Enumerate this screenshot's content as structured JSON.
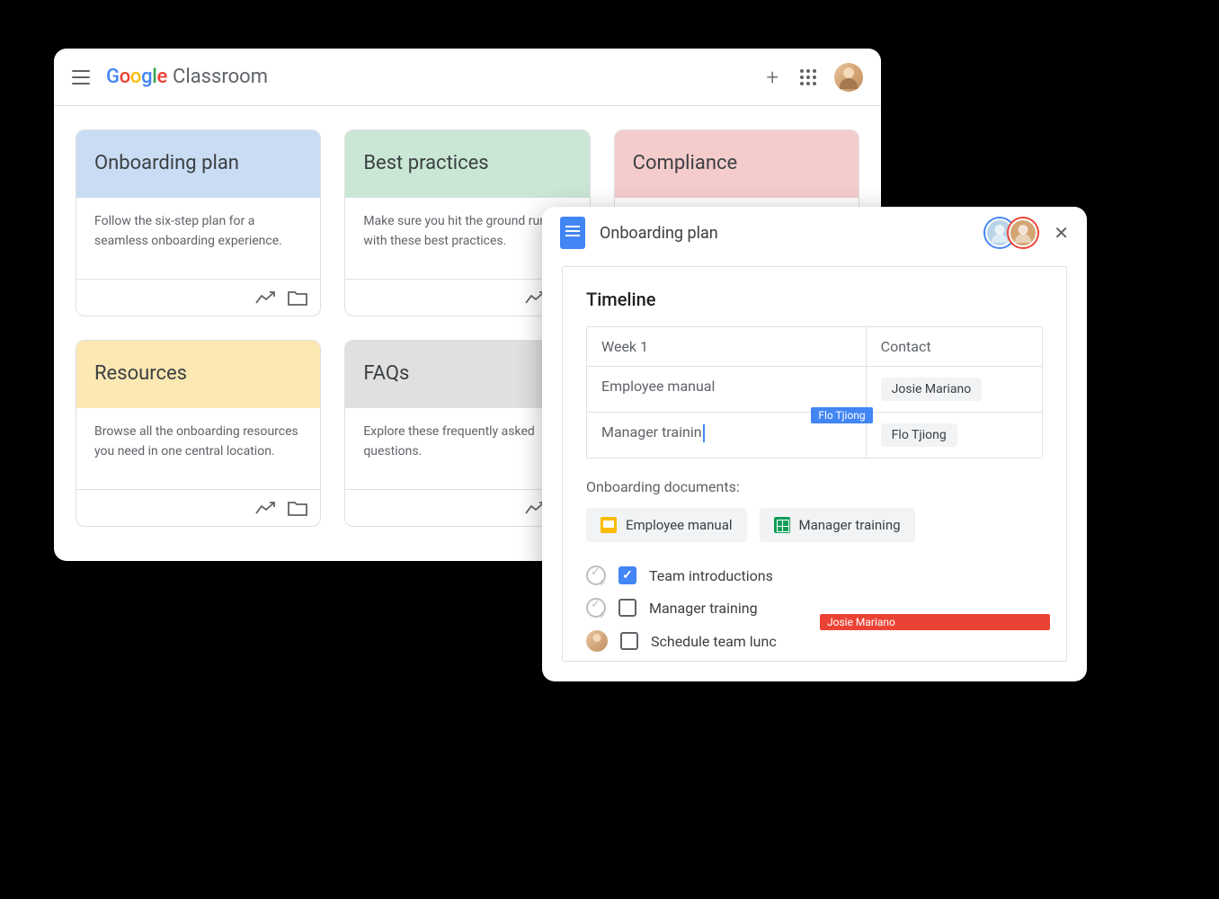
{
  "classroom": {
    "logo_text": "Google",
    "app_name": "Classroom",
    "cards": [
      {
        "title": "Onboarding plan",
        "body": "Follow the six-step plan for a seamless onboarding experience.",
        "color": "ch-blue"
      },
      {
        "title": "Best practices",
        "body": "Make sure you hit the ground running with these best practices.",
        "color": "ch-green"
      },
      {
        "title": "Compliance",
        "body": "",
        "color": "ch-pink"
      },
      {
        "title": "Resources",
        "body": "Browse all the onboarding resources you need in one central location.",
        "color": "ch-yellow"
      },
      {
        "title": "FAQs",
        "body": "Explore these frequently asked questions.",
        "color": "ch-gray"
      }
    ]
  },
  "docs": {
    "title": "Onboarding plan",
    "section_title": "Timeline",
    "table": {
      "header": {
        "left": "Week 1",
        "right": "Contact"
      },
      "rows": [
        {
          "left": "Employee manual",
          "right": "Josie Mariano"
        },
        {
          "left": "Manager trainin",
          "right": "Flo Tjiong",
          "cursor_tag": "Flo Tjiong"
        }
      ]
    },
    "docs_label": "Onboarding documents:",
    "doc_chips": [
      {
        "icon": "slides",
        "label": "Employee manual"
      },
      {
        "icon": "sheets",
        "label": "Manager training"
      }
    ],
    "checklist": [
      {
        "assign": "icon",
        "checked": true,
        "text": "Team introductions"
      },
      {
        "assign": "icon",
        "checked": false,
        "text": "Manager training"
      },
      {
        "assign": "avatar",
        "checked": false,
        "text": "Schedule team lunc",
        "cursor_tag": "Josie Mariano"
      }
    ]
  }
}
